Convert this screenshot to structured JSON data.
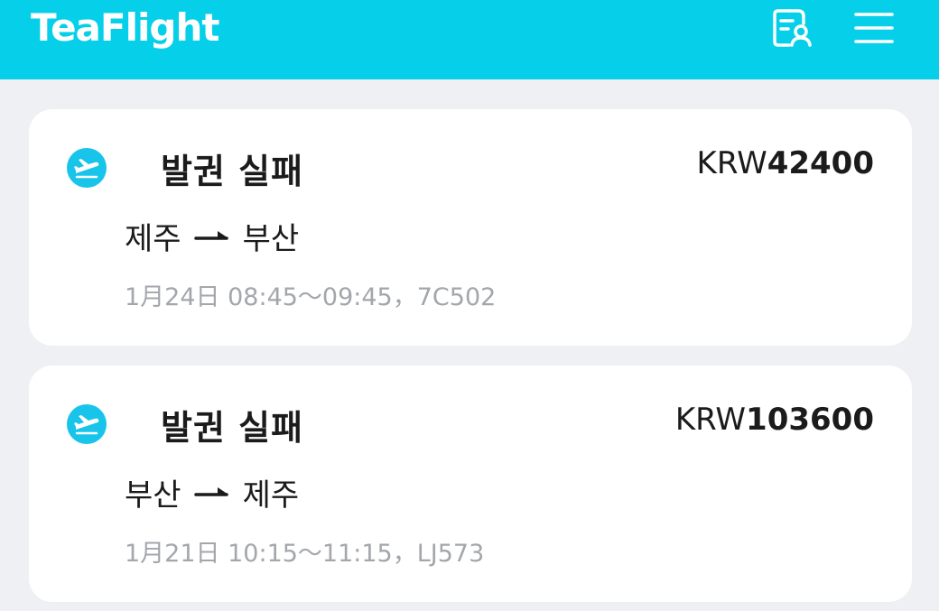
{
  "header": {
    "brand": "TeaFlight",
    "profile_icon": "passenger-list-icon",
    "menu_icon": "hamburger-menu-icon"
  },
  "colors": {
    "brand_bar": "#06cfe9",
    "badge": "#18c4ea",
    "background": "#eef0f3"
  },
  "bookings": [
    {
      "icon": "airplane-icon",
      "status": "발권 실패",
      "currency": "KRW",
      "amount": "42400",
      "origin": "제주",
      "destination": "부산",
      "details": "1月24日 08:45～09:45，7C502"
    },
    {
      "icon": "airplane-icon",
      "status": "발권 실패",
      "currency": "KRW",
      "amount": "103600",
      "origin": "부산",
      "destination": "제주",
      "details": "1月21日 10:15～11:15，LJ573"
    }
  ]
}
